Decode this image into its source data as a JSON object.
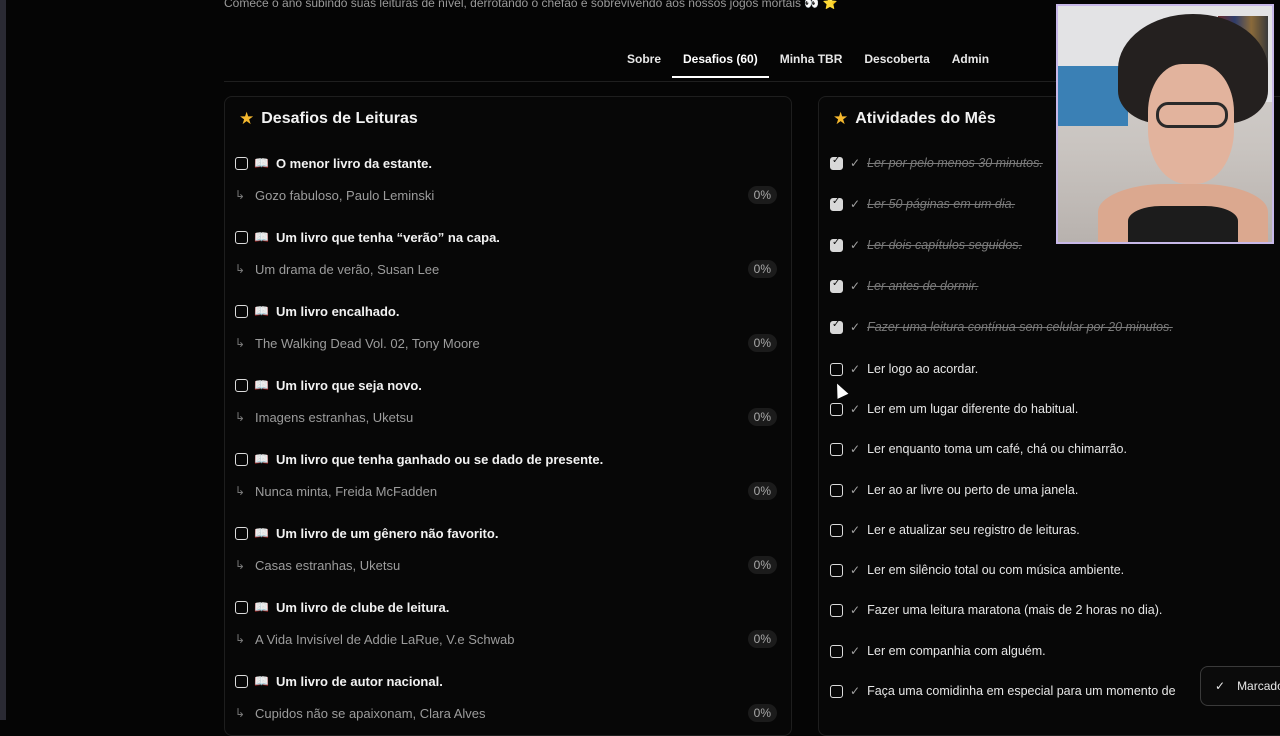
{
  "header": {
    "subtitle": "Comece o ano subindo suas leituras de nível, derrotando o chefão e sobrevivendo aos nossos jogos mortais 👀 ⭐"
  },
  "nav": {
    "tabs": [
      {
        "label": "Sobre",
        "active": false
      },
      {
        "label": "Desafios (60)",
        "active": true
      },
      {
        "label": "Minha TBR",
        "active": false
      },
      {
        "label": "Descoberta",
        "active": false
      },
      {
        "label": "Admin",
        "active": false
      }
    ]
  },
  "challenges": {
    "title": "Desafios de Leituras",
    "items": [
      {
        "title": "O menor livro da estante.",
        "book": "Gozo fabuloso, Paulo Leminski",
        "progress": "0%"
      },
      {
        "title": "Um livro que tenha “verão” na capa.",
        "book": "Um drama de verão, Susan Lee",
        "progress": "0%"
      },
      {
        "title": "Um livro encalhado.",
        "book": "The Walking Dead Vol. 02, Tony Moore",
        "progress": "0%"
      },
      {
        "title": "Um livro que seja novo.",
        "book": "Imagens estranhas, Uketsu",
        "progress": "0%"
      },
      {
        "title": "Um livro que tenha ganhado ou se dado de presente.",
        "book": "Nunca minta, Freida McFadden",
        "progress": "0%"
      },
      {
        "title": "Um livro de um gênero não favorito.",
        "book": "Casas estranhas, Uketsu",
        "progress": "0%"
      },
      {
        "title": "Um livro de clube de leitura.",
        "book": "A Vida Invisível de Addie LaRue, V.e Schwab",
        "progress": "0%"
      },
      {
        "title": "Um livro de autor nacional.",
        "book": "Cupidos não se apaixonam, Clara Alves",
        "progress": "0%"
      }
    ]
  },
  "activities": {
    "title": "Atividades do Mês",
    "items": [
      {
        "label": "Ler por pelo menos 30 minutos.",
        "done": true
      },
      {
        "label": "Ler 50 páginas em um dia.",
        "done": true
      },
      {
        "label": "Ler dois capítulos seguidos.",
        "done": true
      },
      {
        "label": "Ler antes de dormir.",
        "done": true
      },
      {
        "label": "Fazer uma leitura contínua sem celular por 20 minutos.",
        "done": true
      },
      {
        "label": "Ler logo ao acordar.",
        "done": false
      },
      {
        "label": "Ler em um lugar diferente do habitual.",
        "done": false
      },
      {
        "label": "Ler enquanto toma um café, chá ou chimarrão.",
        "done": false
      },
      {
        "label": "Ler ao ar livre ou perto de uma janela.",
        "done": false
      },
      {
        "label": "Ler e atualizar seu registro de leituras.",
        "done": false
      },
      {
        "label": "Ler em silêncio total ou com música ambiente.",
        "done": false
      },
      {
        "label": "Fazer uma leitura maratona (mais de 2 horas no dia).",
        "done": false
      },
      {
        "label": "Ler em companhia com alguém.",
        "done": false
      },
      {
        "label": "Faça uma comidinha em especial para um momento de",
        "done": false
      }
    ]
  },
  "toast": {
    "label": "Marcado"
  }
}
